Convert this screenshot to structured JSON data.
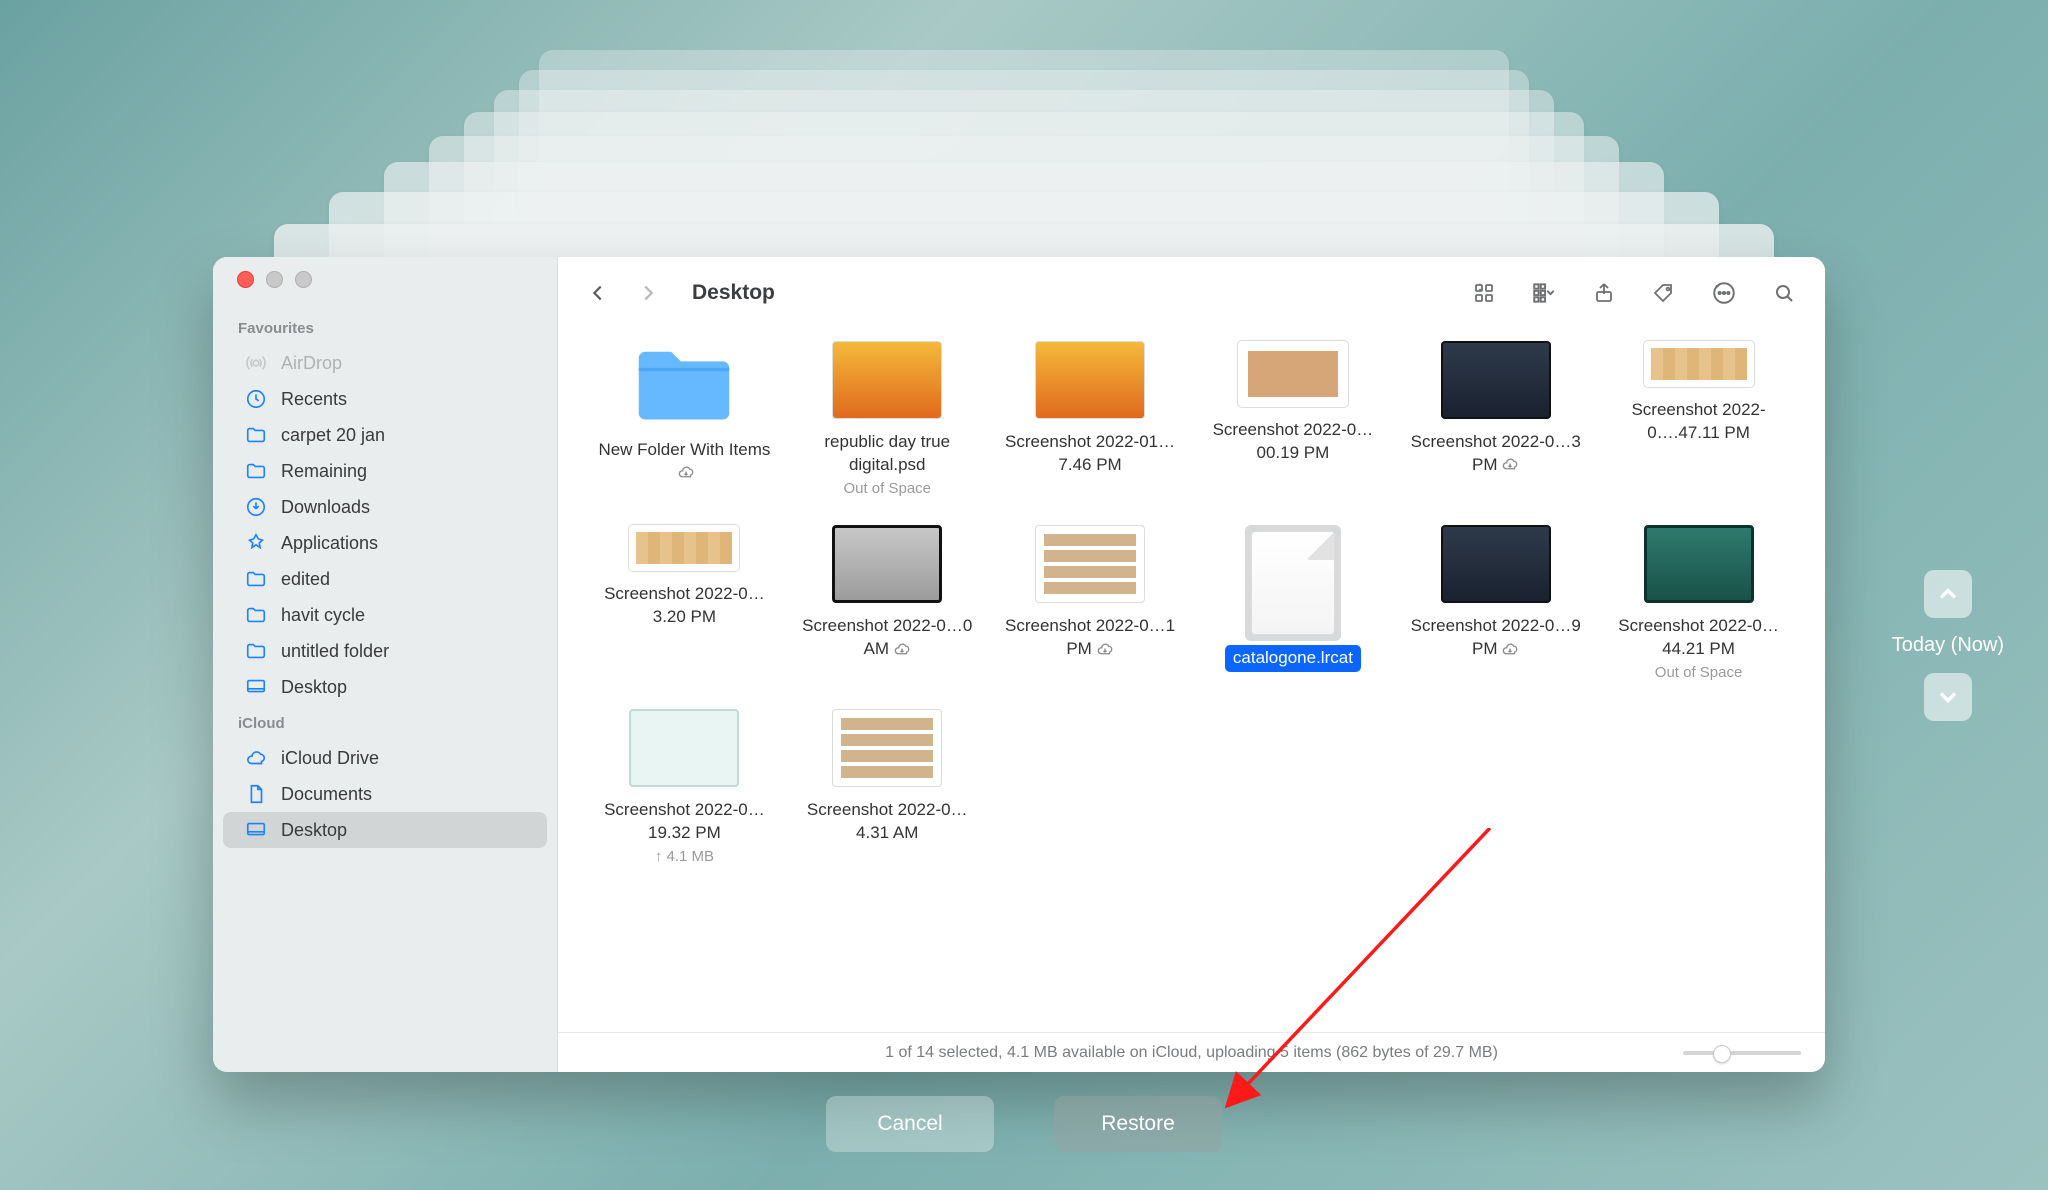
{
  "window": {
    "title": "Desktop"
  },
  "sidebar": {
    "sections": {
      "favourites_label": "Favourites",
      "icloud_label": "iCloud"
    },
    "items": {
      "airdrop": "AirDrop",
      "recents": "Recents",
      "carpet": "carpet 20 jan",
      "remaining": "Remaining",
      "downloads": "Downloads",
      "applications": "Applications",
      "edited": "edited",
      "havit": "havit cycle",
      "untitled": "untitled folder",
      "desktop": "Desktop",
      "icloud_drive": "iCloud Drive",
      "documents": "Documents",
      "desktop2": "Desktop"
    }
  },
  "files": [
    {
      "name": "New Folder With Items",
      "sub": "",
      "cloud": true,
      "selected": false
    },
    {
      "name": "republic day true digital.psd",
      "sub": "Out of Space",
      "cloud": false,
      "selected": false
    },
    {
      "name": "Screenshot 2022-01…7.46 PM",
      "sub": "",
      "cloud": false,
      "selected": false
    },
    {
      "name": "Screenshot 2022-0…00.19 PM",
      "sub": "",
      "cloud": false,
      "selected": false
    },
    {
      "name": "Screenshot 2022-0…3 PM",
      "sub": "",
      "cloud": true,
      "selected": false
    },
    {
      "name": "Screenshot 2022-0….47.11 PM",
      "sub": "",
      "cloud": false,
      "selected": false
    },
    {
      "name": "Screenshot 2022-0…3.20 PM",
      "sub": "",
      "cloud": false,
      "selected": false
    },
    {
      "name": "Screenshot 2022-0…0 AM",
      "sub": "",
      "cloud": true,
      "selected": false
    },
    {
      "name": "Screenshot 2022-0…1 PM",
      "sub": "",
      "cloud": true,
      "selected": false
    },
    {
      "name": "catalogone.lrcat",
      "sub": "",
      "cloud": false,
      "selected": true
    },
    {
      "name": "Screenshot 2022-0…9 PM",
      "sub": "",
      "cloud": true,
      "selected": false
    },
    {
      "name": "Screenshot 2022-0…44.21 PM",
      "sub": "Out of Space",
      "cloud": false,
      "selected": false
    },
    {
      "name": "Screenshot 2022-0…19.32 PM",
      "sub": "↑ 4.1 MB",
      "cloud": false,
      "selected": false
    },
    {
      "name": "Screenshot 2022-0…4.31 AM",
      "sub": "",
      "cloud": false,
      "selected": false
    }
  ],
  "status_bar": "1 of 14 selected, 4.1 MB available on iCloud, uploading 5 items (862 bytes of 29.7 MB)",
  "timeline": {
    "label": "Today (Now)"
  },
  "buttons": {
    "cancel": "Cancel",
    "restore": "Restore"
  }
}
